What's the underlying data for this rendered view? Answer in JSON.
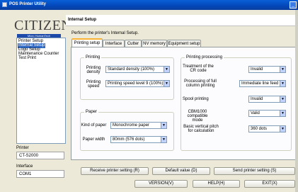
{
  "window": {
    "title": "POS Printer Utility"
  },
  "logo": {
    "brand": "CITIZEN",
    "sub": "Micro HumanTech"
  },
  "menu": {
    "items": [
      "Printer Setup",
      "Internal Setup",
      "Logo Setup",
      "Maintenance Counter",
      "Test Print"
    ],
    "selected": 1
  },
  "printer": {
    "label": "Printer",
    "value": "CT-S2000"
  },
  "interface": {
    "label": "Interface",
    "value": "COM1"
  },
  "header": {
    "title": "Internal Setup"
  },
  "description": "Perform the printer's Internal Setup.",
  "tabs": [
    "Printing setup",
    "Interface",
    "Cutter",
    "NV memory",
    "Equipment setup"
  ],
  "printing": {
    "title": "Printing",
    "density_label": "Printing density",
    "density_value": "Standard density (100%)",
    "speed_label": "Printing speed",
    "speed_value": "Printing speed level 9 (100%)"
  },
  "paper": {
    "title": "Paper",
    "kind_label": "Kind of paper",
    "kind_value": "Monochrome paper",
    "width_label": "Paper width",
    "width_value": "80mm (576 dots)"
  },
  "processing": {
    "title": "Printing processing",
    "cr_label": "Treatment of the CR code",
    "cr_value": "Invalid",
    "fullcol_label": "Processing of full column printing",
    "fullcol_value": "Immediate line feed",
    "spool_label": "Spool printing",
    "spool_value": "Invalid",
    "cbm_label": "CBM1000 compatible mode",
    "cbm_value": "Valid",
    "pitch_label": "Basic vertical pitch for calculation",
    "pitch_value": "360 dots"
  },
  "buttons": {
    "receive": "Receive printer setting (R)",
    "default": "Default value (D)",
    "send": "Send printer setting (S)",
    "version": "VERSION(V)",
    "help": "HELP(H)",
    "exit": "EXIT(X)"
  },
  "colors": {
    "titlebar": "#0347b8",
    "selection": "#316ac5",
    "tab_accent": "#f9b233"
  },
  "icons": [
    "app-icon",
    "window-minimize-icon",
    "dropdown-arrow-icon"
  ]
}
